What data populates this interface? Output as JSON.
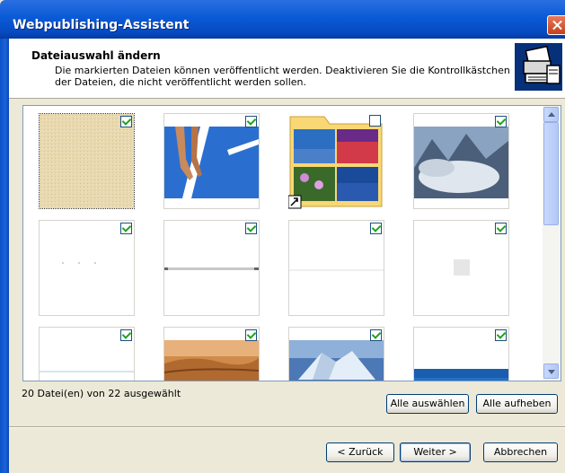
{
  "window": {
    "title": "Webpublishing-Assistent"
  },
  "header": {
    "title": "Dateiauswahl ändern",
    "description": "Die markierten Dateien können veröffentlicht werden. Deaktivieren Sie die Kontrollkästchen der Dateien, die nicht veröffentlicht werden sollen."
  },
  "files": [
    {
      "thumb": "sand-texture",
      "checked": true,
      "selected": true
    },
    {
      "thumb": "tennis-court-hand",
      "checked": true
    },
    {
      "thumb": "photo-folder",
      "checked": false
    },
    {
      "thumb": "misty-mountains",
      "checked": true
    },
    {
      "thumb": "blank-dots",
      "checked": true
    },
    {
      "thumb": "blank-gray-line",
      "checked": true
    },
    {
      "thumb": "blank-faint-line",
      "checked": true
    },
    {
      "thumb": "blank-gray-square",
      "checked": true
    },
    {
      "thumb": "blank-blue-line",
      "checked": true
    },
    {
      "thumb": "desert-dunes",
      "checked": true
    },
    {
      "thumb": "iceberg",
      "checked": true
    },
    {
      "thumb": "blue-band",
      "checked": true
    }
  ],
  "status": {
    "selection_count": "20 Datei(en) von 22 ausgewählt"
  },
  "buttons": {
    "select_all": "Alle auswählen",
    "deselect_all": "Alle aufheben",
    "back": "< Zurück",
    "next": "Weiter >",
    "cancel": "Abbrechen"
  }
}
